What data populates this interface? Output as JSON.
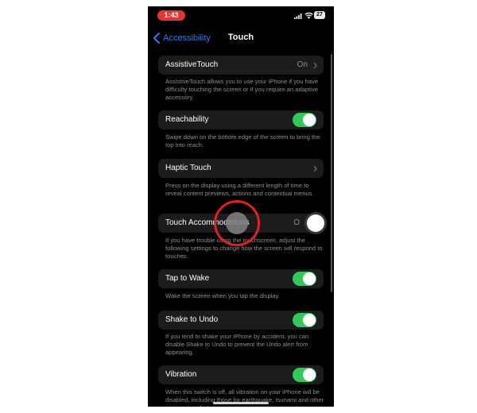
{
  "status_bar": {
    "time": "1:43",
    "battery": "27"
  },
  "nav": {
    "back_label": "Accessibility",
    "title": "Touch"
  },
  "rows": {
    "assistive_touch": {
      "label": "AssistiveTouch",
      "value": "On",
      "footnote": "AssistiveTouch allows you to use your iPhone if you have difficulty touching the screen or if you require an adaptive accessory."
    },
    "reachability": {
      "label": "Reachability",
      "toggle_on": true,
      "footnote": "Swipe down on the bottom edge of the screen to bring the top into reach."
    },
    "haptic_touch": {
      "label": "Haptic Touch",
      "footnote": "Press on the display using a different length of time to reveal content previews, actions and contextual menus."
    },
    "touch_accommodations": {
      "label": "Touch Accommodations",
      "value": "O",
      "footnote": "If you have trouble using the touchscreen, adjust the following settings to change how the screen will respond to touches."
    },
    "tap_to_wake": {
      "label": "Tap to Wake",
      "toggle_on": true,
      "footnote": "Wake the screen when you tap the display."
    },
    "shake_to_undo": {
      "label": "Shake to Undo",
      "toggle_on": true,
      "footnote": "If you tend to shake your iPhone by accident, you can disable Shake to Undo to prevent the Undo alert from appearing."
    },
    "vibration": {
      "label": "Vibration",
      "toggle_on": true,
      "footnote": "When this switch is off, all vibration on your iPhone will be disabled, including those for earthquake, tsunami and other emergency alerts."
    }
  },
  "colors": {
    "accent_blue": "#1e82f2",
    "toggle_green": "#34c759",
    "touch_ring_red": "#e2211c",
    "status_time_red": "#e5352f",
    "cell_background": "#1c1c1e"
  },
  "icons": [
    "chevron-left-icon",
    "chevron-right-icon",
    "signal-icon",
    "wifi-icon",
    "battery-icon"
  ]
}
